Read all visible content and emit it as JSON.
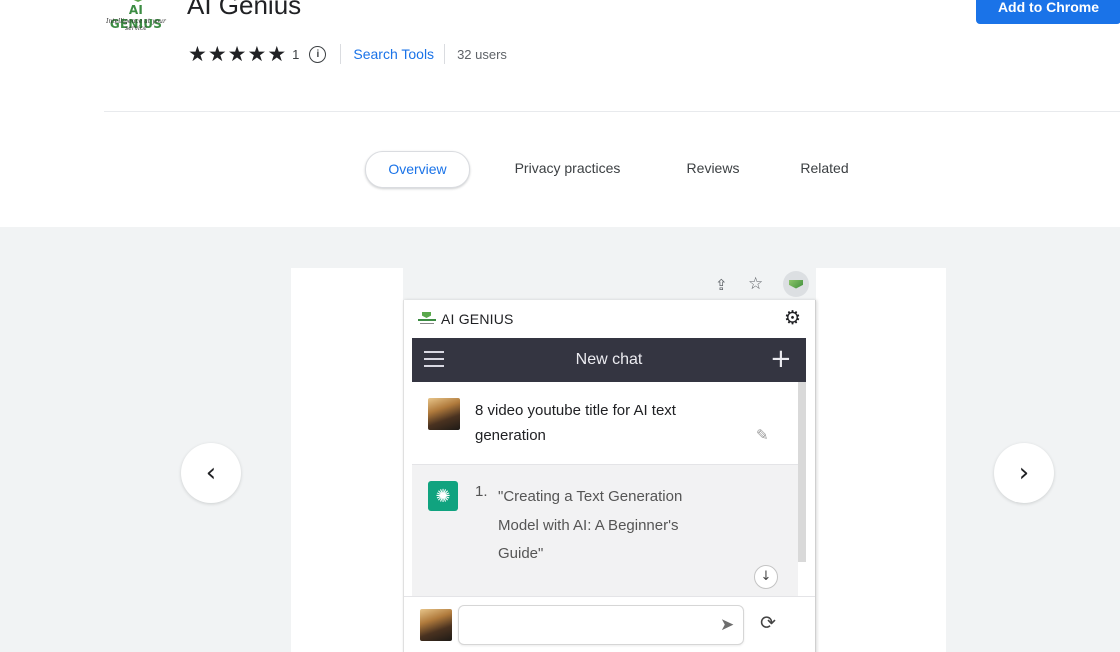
{
  "header": {
    "logo": {
      "brand": "AI GENIUS",
      "tagline": "Intelligence at your service"
    },
    "title": "AI Genius",
    "rating": {
      "stars": 5,
      "count": "1"
    },
    "category": "Search Tools",
    "users": "32 users",
    "add_button": "Add to Chrome"
  },
  "tabs": [
    {
      "label": "Overview",
      "active": true
    },
    {
      "label": "Privacy practices",
      "active": false
    },
    {
      "label": "Reviews",
      "active": false
    },
    {
      "label": "Related",
      "active": false
    }
  ],
  "gallery": {
    "prev_icon": "chevron-left",
    "next_icon": "chevron-right",
    "screenshot": {
      "popup_title": "AI GENIUS",
      "chat_title": "New chat",
      "user_message": "8 video youtube title for AI text generation",
      "assistant_list_number": "1.",
      "assistant_message": "\"Creating a Text Generation Model with AI: A Beginner's Guide\"",
      "input_placeholder": ""
    }
  },
  "colors": {
    "accent": "#1a73e8",
    "chat_bar": "#343541",
    "gpt_green": "#10a37f",
    "gallery_bg": "#f1f3f4"
  }
}
